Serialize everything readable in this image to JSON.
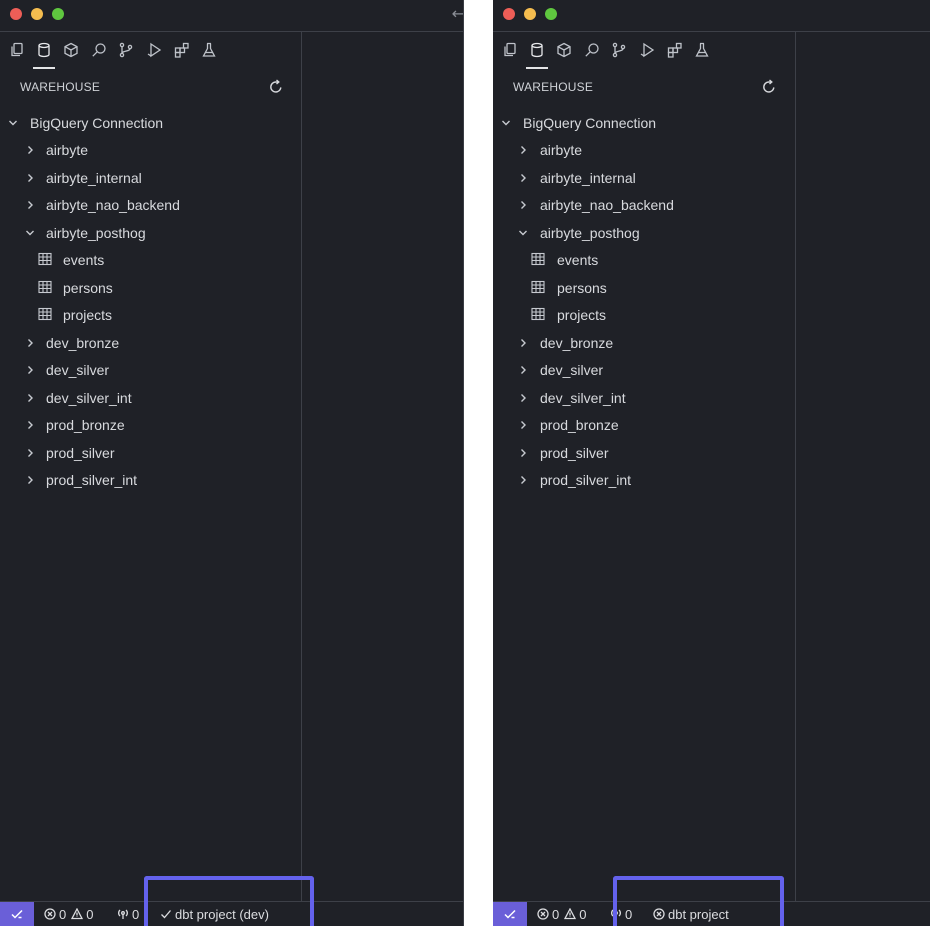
{
  "panels": [
    {
      "section_title": "WAREHOUSE",
      "tree": {
        "root": "BigQuery Connection",
        "datasets": [
          "airbyte",
          "airbyte_internal",
          "airbyte_nao_backend",
          "airbyte_posthog"
        ],
        "tables": [
          "events",
          "persons",
          "projects"
        ],
        "more": [
          "dev_bronze",
          "dev_silver",
          "dev_silver_int",
          "prod_bronze",
          "prod_silver",
          "prod_silver_int"
        ]
      },
      "status": {
        "errors": "0",
        "warnings": "0",
        "ports": "0",
        "dbt": "dbt project (dev)",
        "dbt_state": "ok"
      }
    },
    {
      "section_title": "WAREHOUSE",
      "tree": {
        "root": "BigQuery Connection",
        "datasets": [
          "airbyte",
          "airbyte_internal",
          "airbyte_nao_backend",
          "airbyte_posthog"
        ],
        "tables": [
          "events",
          "persons",
          "projects"
        ],
        "more": [
          "dev_bronze",
          "dev_silver",
          "dev_silver_int",
          "prod_bronze",
          "prod_silver",
          "prod_silver_int"
        ]
      },
      "status": {
        "errors": "0",
        "warnings": "0",
        "ports": "0",
        "dbt": "dbt project",
        "dbt_state": "error"
      }
    }
  ],
  "icons": {
    "activity_bar": [
      "files-icon",
      "database-icon",
      "cube-icon",
      "search-icon",
      "source-control-icon",
      "run-icon",
      "extensions-icon",
      "flask-icon"
    ],
    "refresh": "refresh-icon",
    "table": "table-icon"
  },
  "colors": {
    "highlight": "#6462ec",
    "remote": "#6a5fd8",
    "background": "#1f2127"
  }
}
